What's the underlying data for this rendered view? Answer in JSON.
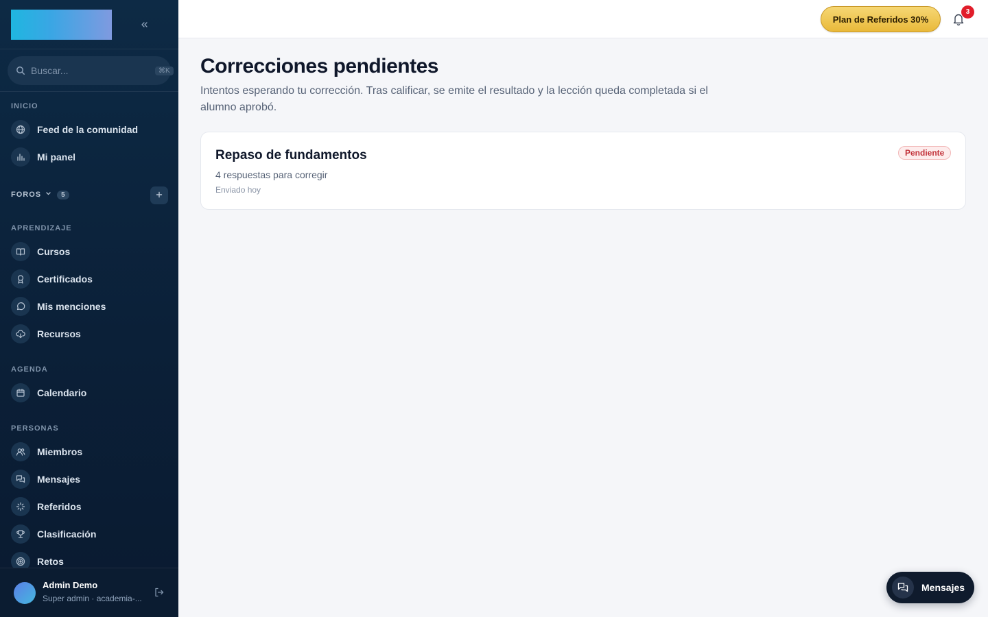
{
  "sidebar": {
    "search_placeholder": "Buscar...",
    "search_shortcut": "⌘K",
    "sections": {
      "inicio": "INICIO",
      "foros": "FOROS",
      "foros_count": "5",
      "aprendizaje": "APRENDIZAJE",
      "agenda": "AGENDA",
      "personas": "PERSONAS"
    },
    "items": {
      "feed": "Feed de la comunidad",
      "panel": "Mi panel",
      "cursos": "Cursos",
      "certificados": "Certificados",
      "menciones": "Mis menciones",
      "recursos": "Recursos",
      "calendario": "Calendario",
      "miembros": "Miembros",
      "mensajes": "Mensajes",
      "referidos": "Referidos",
      "clasificacion": "Clasificación",
      "retos": "Retos"
    },
    "user": {
      "name": "Admin Demo",
      "role": "Super admin · academia-..."
    }
  },
  "topbar": {
    "referral_label": "Plan de Referidos 30%",
    "notification_count": "3"
  },
  "main": {
    "title": "Correcciones pendientes",
    "description": "Intentos esperando tu corrección. Tras calificar, se emite el resultado y la lección queda completada si el alumno aprobó.",
    "items": [
      {
        "title": "Repaso de fundamentos",
        "subtitle": "4 respuestas para corregir",
        "date": "Enviado hoy",
        "status": "Pendiente"
      }
    ]
  },
  "fab": {
    "label": "Mensajes"
  },
  "colors": {
    "sidebar_bg": "#0d2a45",
    "accent_gold": "#e9b93a",
    "badge_red": "#e11d2a",
    "status_pending": "#c2323a"
  }
}
